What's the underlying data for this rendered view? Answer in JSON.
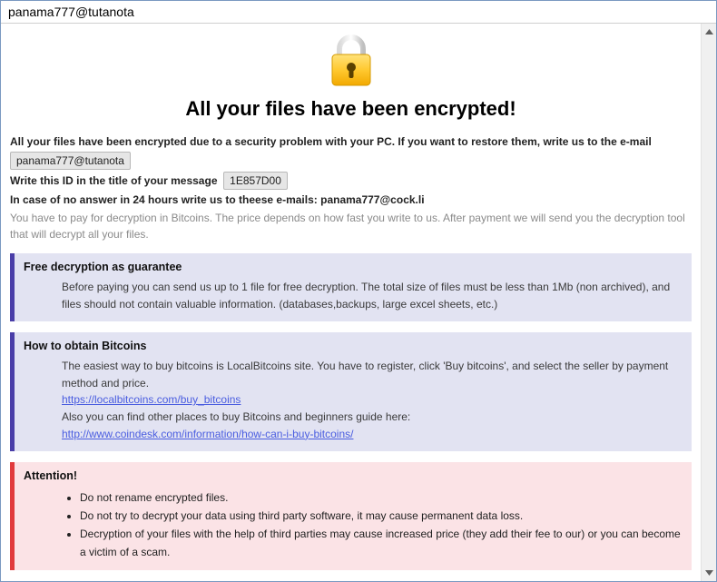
{
  "window": {
    "title": "panama777@tutanota"
  },
  "heading": "All your files have been encrypted!",
  "lines": {
    "l1": "All your files have been encrypted due to a security problem with your PC. If you want to restore them, write us to the e-mail",
    "email1": "panama777@tutanota",
    "l2": "Write this ID in the title of your message",
    "id": "1E857D00",
    "l3a": "In case of no answer in 24 hours write us to theese e-mails:",
    "email2": "panama777@cock.li",
    "l4": "You have to pay for decryption in Bitcoins. The price depends on how fast you write to us. After payment we will send you the decryption tool that will decrypt all your files."
  },
  "panel_guarantee": {
    "title": "Free decryption as guarantee",
    "body": "Before paying you can send us up to 1 file for free decryption. The total size of files must be less than 1Mb (non archived), and files should not contain valuable information. (databases,backups, large excel sheets, etc.)"
  },
  "panel_bitcoins": {
    "title": "How to obtain Bitcoins",
    "body1": "The easiest way to buy bitcoins is LocalBitcoins site. You have to register, click 'Buy bitcoins', and select the seller by payment method and price.",
    "link1": "https://localbitcoins.com/buy_bitcoins",
    "body2": "Also you can find other places to buy Bitcoins and beginners guide here:",
    "link2": "http://www.coindesk.com/information/how-can-i-buy-bitcoins/"
  },
  "panel_attention": {
    "title": "Attention!",
    "items": [
      "Do not rename encrypted files.",
      "Do not try to decrypt your data using third party software, it may cause permanent data loss.",
      "Decryption of your files with the help of third parties may cause increased price (they add their fee to our) or you can become a victim of a scam."
    ]
  }
}
